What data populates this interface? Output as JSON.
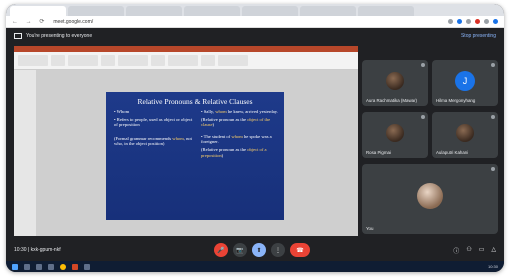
{
  "browser": {
    "tabs": [
      "",
      "",
      "",
      "",
      "",
      "",
      ""
    ],
    "url": "meet.google.com/"
  },
  "presentation_bar": {
    "text": "You're presenting to everyone",
    "stop_label": "Stop presenting"
  },
  "slide": {
    "title": "Relative Pronouns & Relative Clauses",
    "left": {
      "b1": "• Whom",
      "b2": "• Refers to people, used as object or object of preposition",
      "b3_pre": "(Formal grammar recommends ",
      "b3_hl": "whom",
      "b3_post": ", not who, in the object position)"
    },
    "right": {
      "b1_pre": "• Sally, ",
      "b1_hl": "whom",
      "b1_post": " he knew, arrived yesterday.",
      "b2_pre": "(Relative pronoun as the ",
      "b2_hl": "object of the clause",
      "b2_post": ")",
      "b3_pre": "• The student of ",
      "b3_hl": "whom",
      "b3_post": " he spoke was a foreigner.",
      "b4_pre": "(Relative pronoun as the ",
      "b4_hl": "object of a preposition",
      "b4_post": ")"
    }
  },
  "participants": [
    {
      "name": "Aura Rachmatika (Mawar)",
      "type": "photo"
    },
    {
      "name": "Hilma Mergonyhang",
      "type": "letter",
      "initial": "J"
    },
    {
      "name": "Rosa Pigmai",
      "type": "photo"
    },
    {
      "name": "Aulaputri Kahani",
      "type": "photo"
    },
    {
      "name": "You",
      "type": "photo"
    }
  ],
  "meeting": {
    "time": "10:30",
    "code": "kxk-gpum-nkf"
  },
  "controls": {
    "mic": "🎤",
    "camera": "📷",
    "present": "⬆",
    "more": "⋮",
    "end": "☎"
  },
  "taskbar": {
    "time": "10:30"
  },
  "colors": {
    "slide_bg": "#1e3a8a",
    "highlight": "#ffd166",
    "end_call": "#ea4335"
  }
}
